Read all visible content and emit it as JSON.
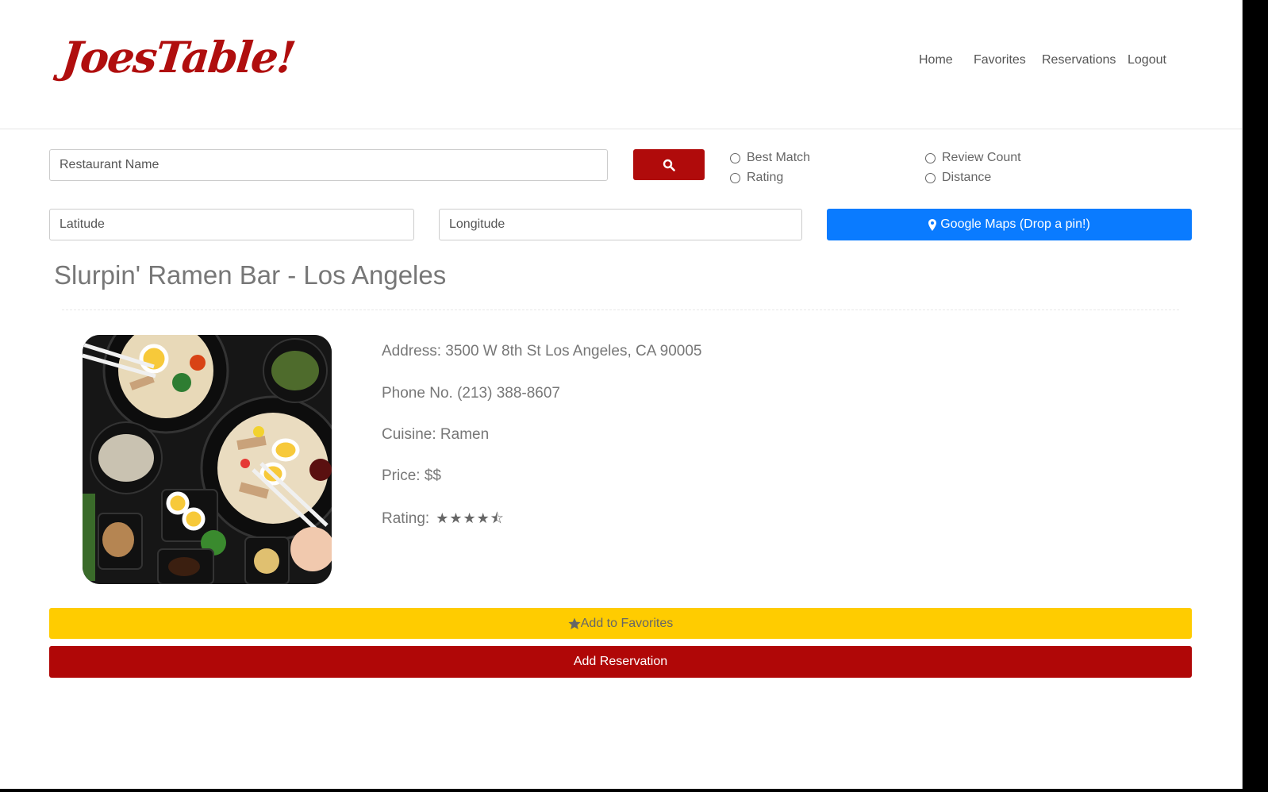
{
  "header": {
    "logo": "JoesTable!",
    "nav": {
      "home": "Home",
      "favorites": "Favorites",
      "reservations": "Reservations",
      "logout": "Logout"
    }
  },
  "search": {
    "name_placeholder": "Restaurant Name",
    "search_icon": "search-icon",
    "sort_options": [
      "Best Match",
      "Rating",
      "Review Count",
      "Distance"
    ],
    "latitude_placeholder": "Latitude",
    "longitude_placeholder": "Longitude",
    "maps_button": "Google Maps (Drop a pin!)",
    "maps_icon": "map-marker-icon"
  },
  "restaurant": {
    "title": "Slurpin' Ramen Bar - Los Angeles",
    "address": "Address: 3500 W 8th St Los Angeles, CA 90005",
    "phone": "Phone No. (213) 388-8607",
    "cuisine": "Cuisine: Ramen",
    "price": "Price: $$",
    "rating_label": "Rating:",
    "rating_value": 4.5,
    "rating_stars": "★★★★⯪"
  },
  "actions": {
    "favorites": "Add to Favorites",
    "reservation": "Add Reservation"
  },
  "colors": {
    "brand_red": "#b00e0e",
    "maps_blue": "#0a7bff",
    "favorites_yellow": "#ffcc00"
  }
}
